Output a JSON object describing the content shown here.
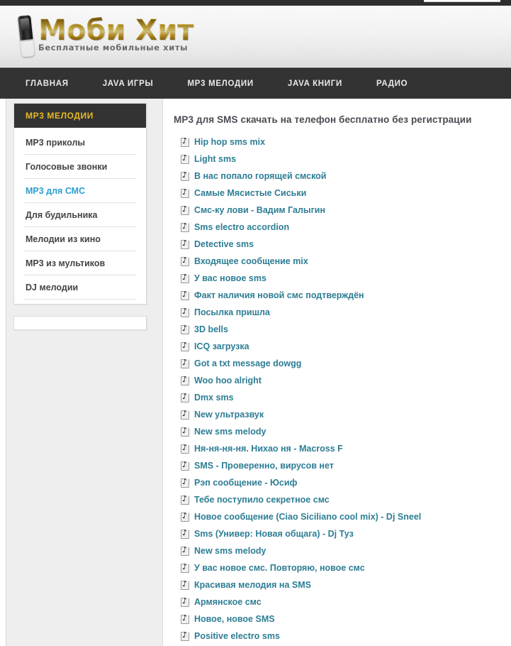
{
  "site": {
    "logo_title": "Моби Хит",
    "logo_subtitle": "Бесплатные мобильные хиты",
    "phone_icon": "mobile-phone-icon"
  },
  "nav": {
    "items": [
      {
        "label": "ГЛАВНАЯ"
      },
      {
        "label": "JAVA ИГРЫ"
      },
      {
        "label": "MP3 МЕЛОДИИ"
      },
      {
        "label": "JAVA КНИГИ"
      },
      {
        "label": "РАДИО"
      }
    ]
  },
  "sidebar": {
    "heading": "MP3 МЕЛОДИИ",
    "items": [
      {
        "label": "MP3 приколы",
        "active": false
      },
      {
        "label": "Голосовые звонки",
        "active": false
      },
      {
        "label": "MP3 для СМС",
        "active": true
      },
      {
        "label": "Для будильника",
        "active": false
      },
      {
        "label": "Мелодии из кино",
        "active": false
      },
      {
        "label": "MP3 из мультиков",
        "active": false
      },
      {
        "label": "DJ мелодии",
        "active": false
      }
    ]
  },
  "main": {
    "title": "MP3 для SMS скачать на телефон бесплатно без регистрации",
    "track_icon": "music-note-file-icon",
    "tracks": [
      {
        "label": "Hip hop sms mix"
      },
      {
        "label": "Light sms"
      },
      {
        "label": "В нас попало горящей смской"
      },
      {
        "label": "Самые Мясистые Сиськи"
      },
      {
        "label": "Смс-ку лови - Вадим Галыгин"
      },
      {
        "label": "Sms electro accordion"
      },
      {
        "label": "Detective sms"
      },
      {
        "label": "Входящее сообщение mix"
      },
      {
        "label": "У вас новое sms"
      },
      {
        "label": "Факт наличия новой смс подтверждён"
      },
      {
        "label": "Посылка пришла"
      },
      {
        "label": "3D bells"
      },
      {
        "label": "ICQ загрузка"
      },
      {
        "label": "Got a txt message dowgg"
      },
      {
        "label": "Woo hoo alright"
      },
      {
        "label": "Dmx sms"
      },
      {
        "label": "New ультразвук"
      },
      {
        "label": "New sms melody"
      },
      {
        "label": "Ня-ня-ня-ня. Нихао ня - Macross F"
      },
      {
        "label": "SMS - Проверенно, вирусов нет"
      },
      {
        "label": "Рэп сообщение - Юсиф"
      },
      {
        "label": "Тебе поступило секретное смс"
      },
      {
        "label": "Новое сообщение (Ciao Siciliano cool mix) - Dj Sneel"
      },
      {
        "label": "Sms (Универ: Новая общага) - Dj Туз"
      },
      {
        "label": "New sms melody"
      },
      {
        "label": "У вас новое смс. Повторяю, новое смс"
      },
      {
        "label": "Красивая мелодия на SMS"
      },
      {
        "label": "Армянское смс"
      },
      {
        "label": "Новое, новое SMS"
      },
      {
        "label": "Positive electro sms"
      }
    ]
  },
  "colors": {
    "nav_bg": "#333333",
    "accent_gold": "#e8b923",
    "link_teal": "#2d7d94",
    "sidebar_active": "#2f9fd0",
    "page_bg": "#eeeeee"
  }
}
